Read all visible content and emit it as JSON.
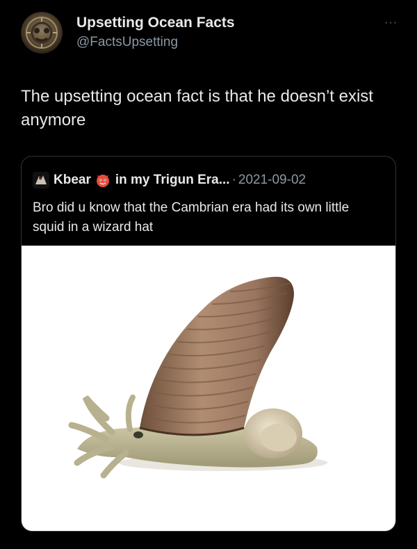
{
  "tweet": {
    "display_name": "Upsetting Ocean Facts",
    "handle": "@FactsUpsetting",
    "more_label": "···",
    "text": "The upsetting ocean fact is that he doesn’t exist anymore"
  },
  "quote": {
    "name": "Kbear",
    "name_suffix": "in my Trigun Era...",
    "separator": "·",
    "date": "2021-09-02",
    "text": "Bro did u know that the Cambrian era had its own little squid in a wizard hat"
  },
  "icons": {
    "avatar": "ornate-medallion-avatar",
    "quote_avatar": "small-avatar-icon",
    "name_emoji": "red-devil-emoji-icon",
    "more": "more-options-icon"
  },
  "colors": {
    "background": "#000000",
    "text_primary": "#e7e9ea",
    "text_secondary": "#8b98a5",
    "border": "#2f3336"
  }
}
